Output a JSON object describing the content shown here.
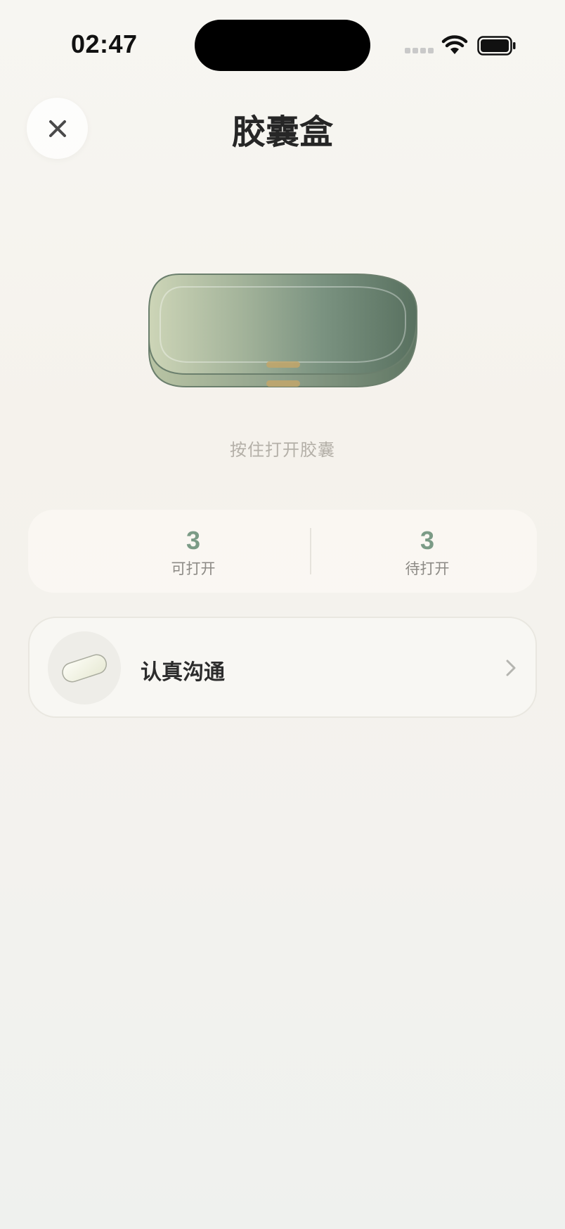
{
  "status_bar": {
    "time": "02:47",
    "icons": [
      "signal-icon",
      "wifi-icon",
      "battery-icon"
    ]
  },
  "header": {
    "title": "胶囊盒",
    "close_icon": "close-icon"
  },
  "capsule_box": {
    "hint": "按住打开胶囊"
  },
  "stats": [
    {
      "value": "3",
      "label": "可打开"
    },
    {
      "value": "3",
      "label": "待打开"
    }
  ],
  "capsules": [
    {
      "name": "认真沟通",
      "icon": "capsule-pill-icon"
    }
  ],
  "colors": {
    "accent_green": "#7b9b86",
    "box_green_light": "#c8d2b4",
    "box_green_dark": "#5a7160",
    "latch_gold": "#c2a66a"
  }
}
